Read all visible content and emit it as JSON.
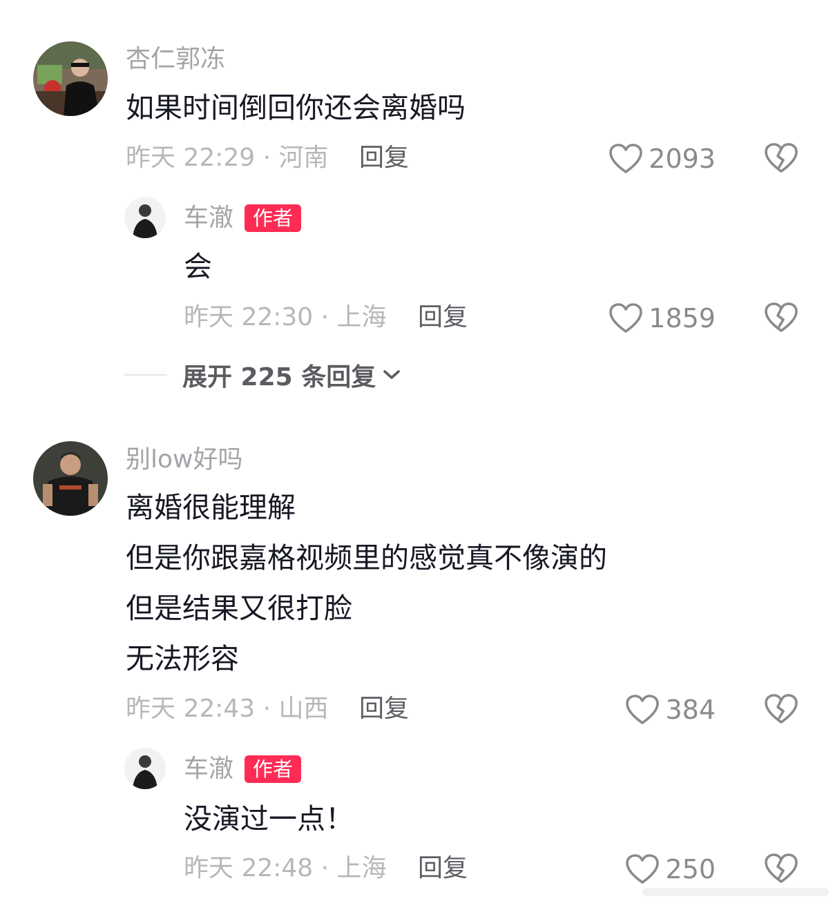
{
  "comments": [
    {
      "username": "杏仁郭冻",
      "text_lines": [
        "如果时间倒回你还会离婚吗"
      ],
      "meta": "昨天 22:29 · 河南",
      "reply_label": "回复",
      "likes": "2093",
      "replies": [
        {
          "username": "车澈",
          "badge": "作者",
          "text_lines": [
            "会"
          ],
          "meta": "昨天 22:30 · 上海",
          "reply_label": "回复",
          "likes": "1859"
        }
      ],
      "expand_label": "展开 225 条回复"
    },
    {
      "username": "别low好吗",
      "text_lines": [
        "离婚很能理解",
        "但是你跟嘉格视频里的感觉真不像演的",
        "但是结果又很打脸",
        "无法形容"
      ],
      "meta": "昨天 22:43 · 山西",
      "reply_label": "回复",
      "likes": "384",
      "replies": [
        {
          "username": "车澈",
          "badge": "作者",
          "text_lines": [
            "没演过一点！"
          ],
          "meta": "昨天 22:48 · 上海",
          "reply_label": "回复",
          "likes": "250"
        }
      ]
    }
  ],
  "colors": {
    "badge_bg": "#fe2c55",
    "username": "#a3a3a8",
    "meta": "#b7b7bb",
    "text": "#161823",
    "icon": "#8a8a8e"
  },
  "icons": {
    "like": "heart-outline-icon",
    "dislike": "broken-heart-icon",
    "expand": "chevron-down-icon"
  }
}
